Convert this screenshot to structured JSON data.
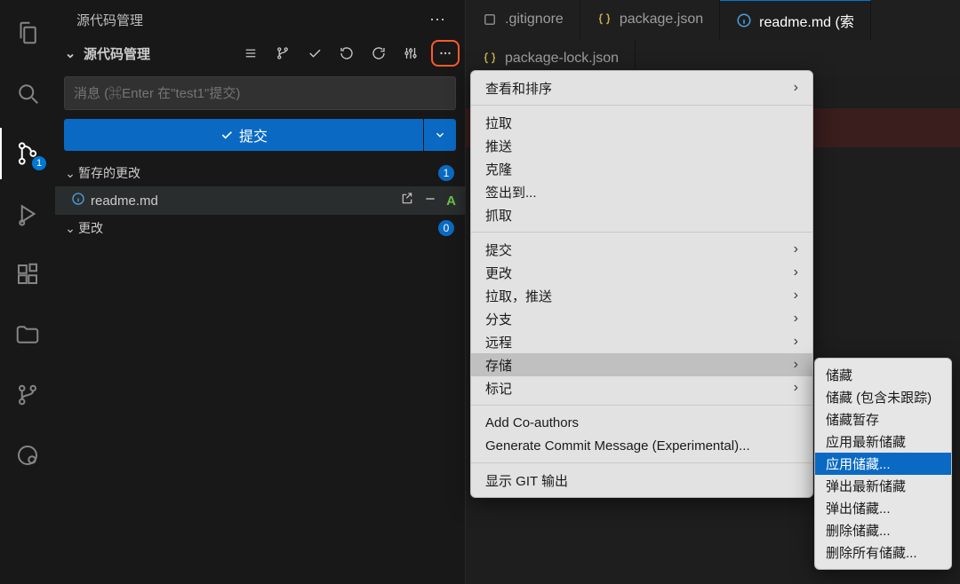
{
  "activity": {
    "scm_badge": "1"
  },
  "panel": {
    "title": "源代码管理",
    "section_title": "源代码管理",
    "commit_placeholder": "消息 (⌘Enter 在\"test1\"提交)",
    "commit_button": "提交",
    "staged_title": "暂存的更改",
    "staged_count": "1",
    "staged_file": "readme.md",
    "staged_status": "A",
    "changes_title": "更改",
    "changes_count": "0"
  },
  "tabs": {
    "row1": [
      {
        "icon": "git",
        "label": ".gitignore"
      },
      {
        "icon": "json",
        "label": "package.json"
      },
      {
        "icon": "info",
        "label": "readme.md (索",
        "active": true
      }
    ],
    "row2": [
      {
        "icon": "json",
        "label": "package-lock.json"
      }
    ],
    "open_editor": {
      "label": "readme.md",
      "modified": true
    }
  },
  "menu": {
    "items": [
      {
        "label": "查看和排序",
        "submenu": true
      },
      {
        "sep": true
      },
      {
        "label": "拉取"
      },
      {
        "label": "推送"
      },
      {
        "label": "克隆"
      },
      {
        "label": "签出到..."
      },
      {
        "label": "抓取"
      },
      {
        "sep": true
      },
      {
        "label": "提交",
        "submenu": true
      },
      {
        "label": "更改",
        "submenu": true
      },
      {
        "label": "拉取，推送",
        "submenu": true
      },
      {
        "label": "分支",
        "submenu": true
      },
      {
        "label": "远程",
        "submenu": true
      },
      {
        "label": "存储",
        "submenu": true,
        "highlight": true
      },
      {
        "label": "标记",
        "submenu": true
      },
      {
        "sep": true
      },
      {
        "label": "Add Co-authors"
      },
      {
        "label": "Generate Commit Message (Experimental)..."
      },
      {
        "sep": true
      },
      {
        "label": "显示 GIT 输出"
      }
    ]
  },
  "submenu": {
    "items": [
      {
        "label": "储藏"
      },
      {
        "label": "储藏 (包含未跟踪)"
      },
      {
        "label": "储藏暂存"
      },
      {
        "label": "应用最新储藏"
      },
      {
        "label": "应用储藏...",
        "selected": true
      },
      {
        "label": "弹出最新储藏"
      },
      {
        "label": "弹出储藏..."
      },
      {
        "label": "删除储藏..."
      },
      {
        "label": "删除所有储藏..."
      }
    ]
  }
}
